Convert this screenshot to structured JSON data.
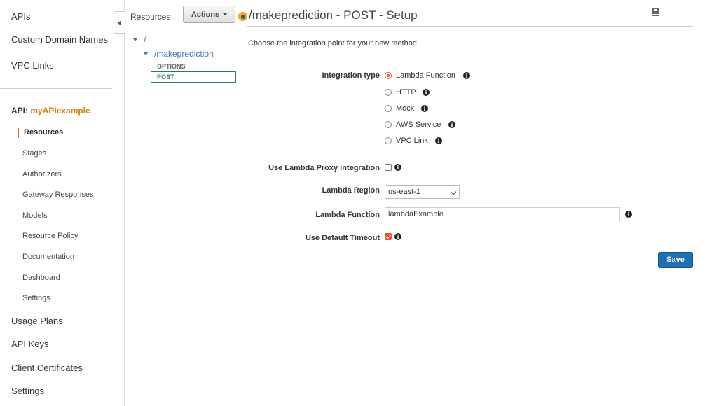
{
  "nav": {
    "top_items": [
      {
        "label": "APIs"
      },
      {
        "label": "Custom Domain Names"
      },
      {
        "label": "VPC Links"
      }
    ],
    "api_prefix": "API:",
    "api_name": "myAPIexample",
    "api_items": [
      {
        "label": "Resources"
      },
      {
        "label": "Stages"
      },
      {
        "label": "Authorizers"
      },
      {
        "label": "Gateway Responses"
      },
      {
        "label": "Models"
      },
      {
        "label": "Resource Policy"
      },
      {
        "label": "Documentation"
      },
      {
        "label": "Dashboard"
      },
      {
        "label": "Settings"
      }
    ],
    "bottom_items": [
      {
        "label": "Usage Plans"
      },
      {
        "label": "API Keys"
      },
      {
        "label": "Client Certificates"
      },
      {
        "label": "Settings"
      }
    ],
    "active_item": "Resources"
  },
  "resources_panel": {
    "label": "Resources",
    "actions_label": "Actions",
    "tree": {
      "root": "/",
      "child": "/makeprediction",
      "methods": [
        "OPTIONS",
        "POST"
      ],
      "selected_method": "POST"
    }
  },
  "main": {
    "title": "/makeprediction - POST - Setup",
    "intro": "Choose the integration point for your new method.",
    "integration_type_label": "Integration type",
    "integration_options": [
      {
        "label": "Lambda Function",
        "selected": true
      },
      {
        "label": "HTTP",
        "selected": false
      },
      {
        "label": "Mock",
        "selected": false
      },
      {
        "label": "AWS Service",
        "selected": false
      },
      {
        "label": "VPC Link",
        "selected": false
      }
    ],
    "proxy_label": "Use Lambda Proxy integration",
    "proxy_checked": false,
    "region_label": "Lambda Region",
    "region_value": "us-east-1",
    "function_label": "Lambda Function",
    "function_value": "lambdaExample",
    "timeout_label": "Use Default Timeout",
    "timeout_checked": true,
    "save_label": "Save"
  },
  "colors": {
    "accent_orange": "#e07b00",
    "radio_selected": "#e4572e",
    "link_blue": "#3a78b5",
    "save_button": "#1f6fb5",
    "post_green": "#2f8a5a"
  },
  "icons": [
    "collapse-left-icon",
    "caret-down-icon",
    "tree-expand-icon",
    "info-icon",
    "book-icon",
    "status-dot-icon"
  ]
}
